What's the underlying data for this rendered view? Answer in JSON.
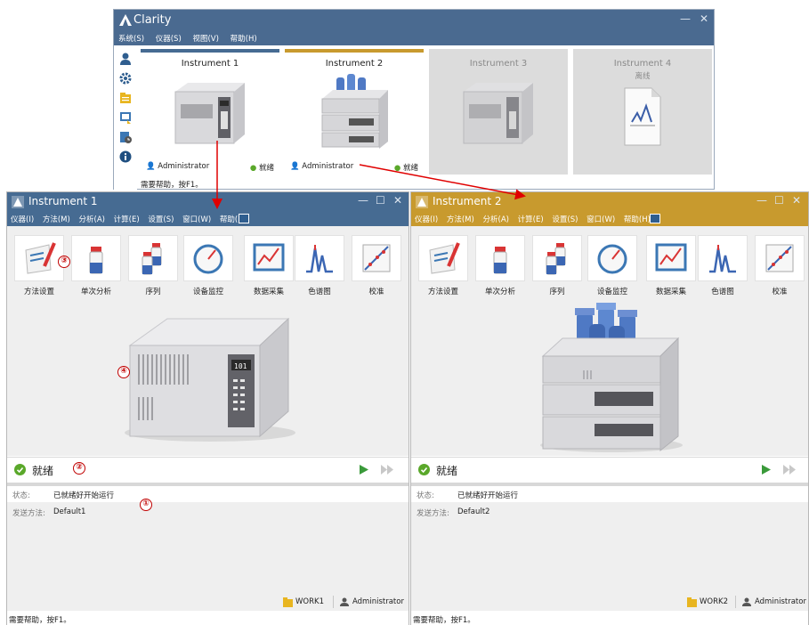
{
  "colors": {
    "main_title": "#4a6a90",
    "inst1_title": "#466b92",
    "inst2_title": "#c89a2e",
    "ready_green": "#5aa82a",
    "callout_red": "#c00000",
    "arrow_red": "#e00000"
  },
  "main": {
    "title": "Clarity",
    "menu": [
      "系统(S)",
      "仪器(S)",
      "视图(V)",
      "帮助(H)"
    ],
    "status": "需要帮助，按F1。",
    "cards": [
      {
        "name": "Instrument 1",
        "sub": "",
        "user": "Administrator",
        "status": "就绪"
      },
      {
        "name": "Instrument 2",
        "sub": "",
        "user": "Administrator",
        "status": "就绪"
      },
      {
        "name": "Instrument 3",
        "sub": "",
        "user": "",
        "status": ""
      },
      {
        "name": "Instrument 4",
        "sub": "离线",
        "user": "",
        "status": ""
      }
    ]
  },
  "inst1": {
    "title": "Instrument 1",
    "menu": [
      "仪器(I)",
      "方法(M)",
      "分析(A)",
      "计算(E)",
      "设置(S)",
      "窗口(W)",
      "帮助(H)"
    ],
    "tools": [
      "方法设置",
      "单次分析",
      "序列",
      "设备监控",
      "数据采集",
      "色谱图",
      "校准"
    ],
    "ready": "就绪",
    "state_label": "状态:",
    "state_value": "已就绪好开始运行",
    "method_label": "发送方法:",
    "method_value": "Default1",
    "work": "WORK1",
    "user": "Administrator",
    "bottom_status": "需要帮助，按F1。"
  },
  "inst2": {
    "title": "Instrument 2",
    "menu": [
      "仪器(I)",
      "方法(M)",
      "分析(A)",
      "计算(E)",
      "设置(S)",
      "窗口(W)",
      "帮助(H)"
    ],
    "tools": [
      "方法设置",
      "单次分析",
      "序列",
      "设备监控",
      "数据采集",
      "色谱图",
      "校准"
    ],
    "ready": "就绪",
    "state_label": "状态:",
    "state_value": "已就绪好开始运行",
    "method_label": "发送方法:",
    "method_value": "Default2",
    "work": "WORK2",
    "user": "Administrator",
    "bottom_status": "需要帮助，按F1。"
  },
  "callouts": [
    "①",
    "②",
    "③",
    "④"
  ]
}
